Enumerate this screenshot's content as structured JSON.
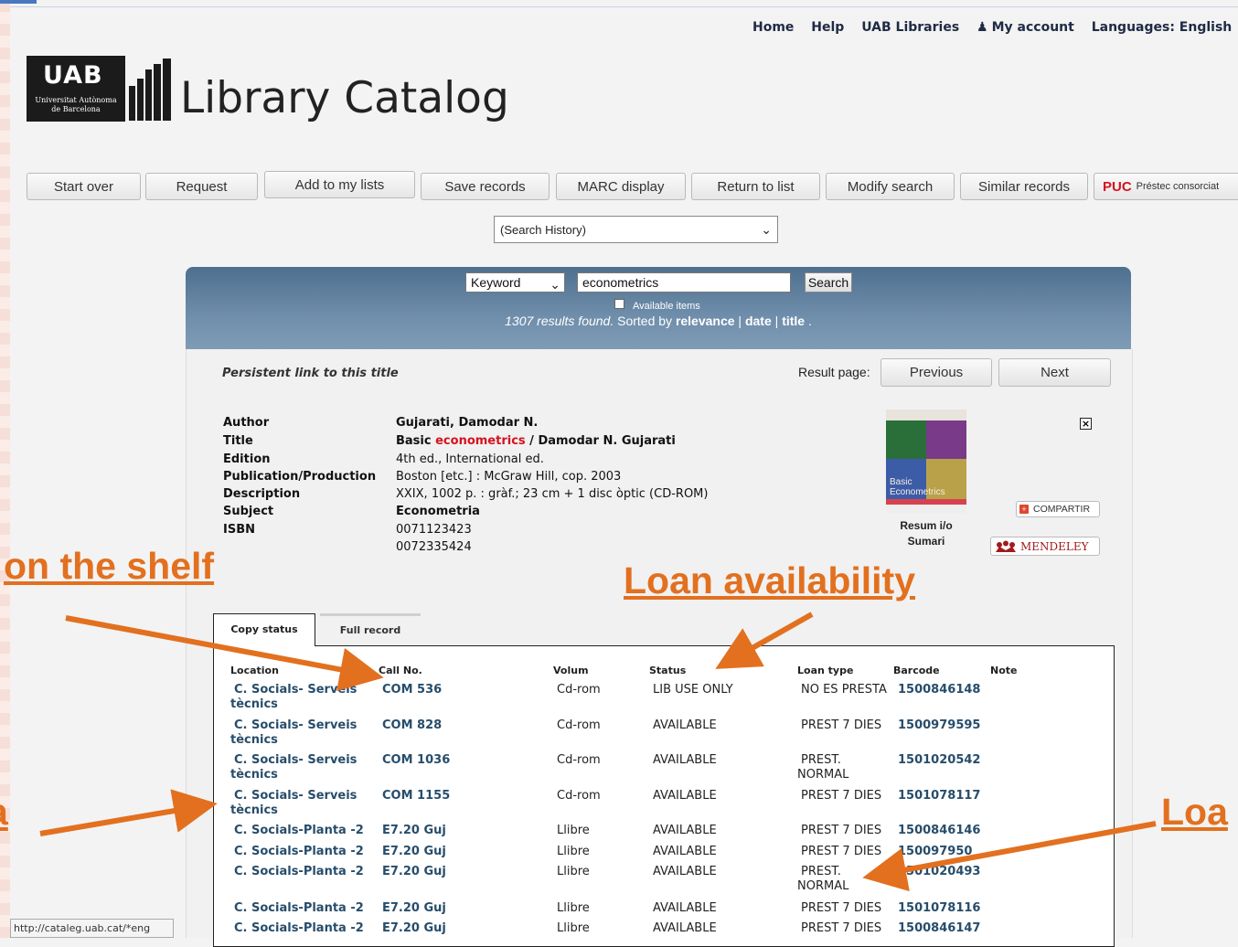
{
  "topnav": {
    "home": "Home",
    "help": "Help",
    "uab_libraries": "UAB Libraries",
    "my_account": "My account",
    "languages": "Languages: English"
  },
  "logo": {
    "wordmark": "UAB",
    "subtitle_line1": "Universitat Autònoma",
    "subtitle_line2": "de Barcelona",
    "catalog_title": "Library Catalog"
  },
  "toolbar": {
    "start_over": "Start over",
    "request": "Request",
    "add_to_lists": "Add to my lists",
    "save_records": "Save records",
    "marc_display": "MARC display",
    "return_to_list": "Return to list",
    "modify_search": "Modify search",
    "similar_records": "Similar records",
    "puc_label": "PUC",
    "puc_sub": "Préstec consorciat"
  },
  "search_history": "(Search History)",
  "search": {
    "type": "Keyword",
    "query": "econometrics",
    "button": "Search",
    "available_items": "Available items",
    "results_count_text": "1307 results found.",
    "sorted_by": " Sorted by ",
    "sort_relevance": "relevance",
    "sort_sep1": " | ",
    "sort_date": "date",
    "sort_sep2": " | ",
    "sort_title": "title",
    "sort_end": " ."
  },
  "record_nav": {
    "persistent_link": "Persistent link to this title",
    "result_page": "Result page:",
    "previous": "Previous",
    "next": "Next"
  },
  "record": {
    "labels": {
      "author": "Author",
      "title": "Title",
      "edition": "Edition",
      "publication": "Publication/Production",
      "description": "Description",
      "subject": "Subject",
      "isbn": "ISBN"
    },
    "author": "Gujarati, Damodar N.",
    "title_pre": "Basic ",
    "title_highlight": "econometrics",
    "title_post": " / Damodar N. Gujarati",
    "edition": "4th ed., International ed.",
    "publication": "Boston [etc.] : McGraw Hill, cop. 2003",
    "description": "XXIX, 1002 p. : gràf.; 23 cm + 1 disc òptic (CD-ROM)",
    "subject": "Econometria",
    "isbn1": "0071123423",
    "isbn2": "0072335424",
    "cover_text": "Basic Econometrics",
    "resum_line1": "Resum i/o",
    "resum_line2": "Sumari",
    "compartir": "COMPARTIR",
    "mendeley": "MENDELEY"
  },
  "tabs": {
    "copy_status": "Copy status",
    "full_record": "Full record"
  },
  "table": {
    "headers": {
      "location": "Location",
      "callno": "Call No.",
      "volum": "Volum",
      "status": "Status",
      "loantype": "Loan type",
      "barcode": "Barcode",
      "note": "Note"
    },
    "rows": [
      {
        "location": "C. Socials- Serveis tècnics",
        "callno": "COM 536",
        "volum": "Cd-rom",
        "status": "LIB USE ONLY",
        "loantype": "NO ES PRESTA",
        "barcode": "1500846148"
      },
      {
        "location": "C. Socials- Serveis tècnics",
        "callno": "COM 828",
        "volum": "Cd-rom",
        "status": "AVAILABLE",
        "loantype": "PREST 7 DIES",
        "barcode": "1500979595"
      },
      {
        "location": "C. Socials- Serveis tècnics",
        "callno": "COM 1036",
        "volum": "Cd-rom",
        "status": "AVAILABLE",
        "loantype": "PREST. NORMAL",
        "barcode": "1501020542"
      },
      {
        "location": "C. Socials- Serveis tècnics",
        "callno": "COM 1155",
        "volum": "Cd-rom",
        "status": "AVAILABLE",
        "loantype": "PREST 7 DIES",
        "barcode": "1501078117"
      },
      {
        "location": "C. Socials-Planta -2",
        "callno": "E7.20 Guj",
        "volum": "Llibre",
        "status": "AVAILABLE",
        "loantype": "PREST 7 DIES",
        "barcode": "1500846146"
      },
      {
        "location": "C. Socials-Planta -2",
        "callno": "E7.20 Guj",
        "volum": "Llibre",
        "status": "AVAILABLE",
        "loantype": "PREST 7 DIES",
        "barcode": "150097950"
      },
      {
        "location": "C. Socials-Planta -2",
        "callno": "E7.20 Guj",
        "volum": "Llibre",
        "status": "AVAILABLE",
        "loantype": "PREST. NORMAL",
        "barcode": "1501020493"
      },
      {
        "location": "C. Socials-Planta -2",
        "callno": "E7.20 Guj",
        "volum": "Llibre",
        "status": "AVAILABLE",
        "loantype": "PREST 7 DIES",
        "barcode": "1501078116"
      },
      {
        "location": "C. Socials-Planta -2",
        "callno": "E7.20 Guj",
        "volum": "Llibre",
        "status": "AVAILABLE",
        "loantype": "PREST 7 DIES",
        "barcode": "1500846147"
      }
    ]
  },
  "annotations": {
    "on_shelf": "on the shelf",
    "loan_availability": "Loan availability",
    "loan_right": "Loa",
    "left_fragment": "a"
  },
  "annotation_color": "#e2701f",
  "status_url": "http://cataleg.uab.cat/*eng"
}
